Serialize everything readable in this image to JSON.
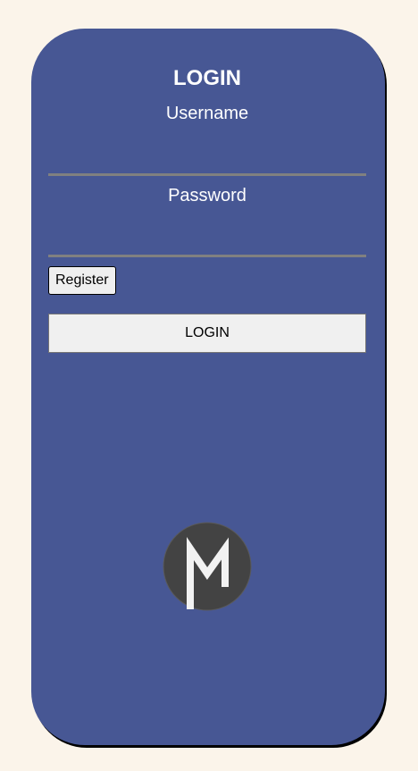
{
  "login_card": {
    "title": "LOGIN",
    "username_label": "Username",
    "username_value": "",
    "password_label": "Password",
    "password_value": "",
    "register_label": "Register",
    "login_button_label": "LOGIN"
  },
  "logo": {
    "icon": "m-logo-icon",
    "letter": "M"
  },
  "colors": {
    "page_background": "#fbf4ea",
    "card_background": "#475794",
    "logo_background": "#434343",
    "input_underline": "#808080"
  }
}
